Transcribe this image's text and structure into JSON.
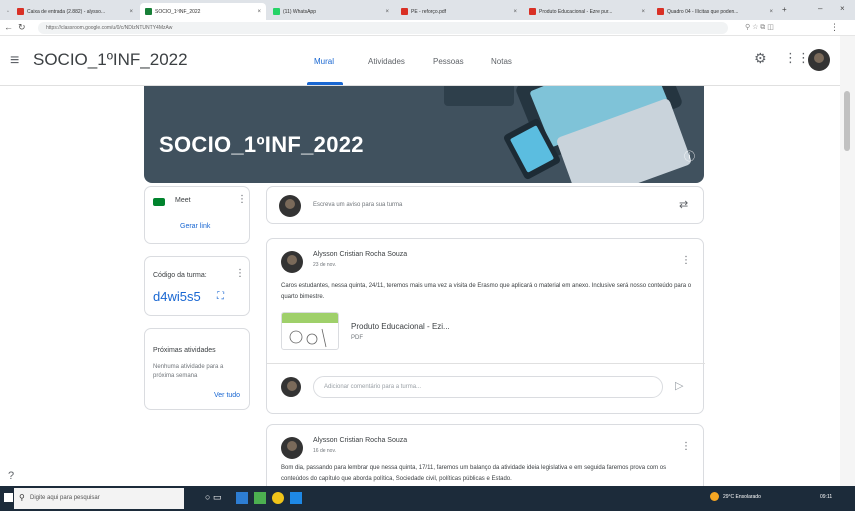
{
  "browser": {
    "tabs": [
      {
        "label": "Caixa de entrada (2.882) - alysso...",
        "color": "#d93025",
        "active": false
      },
      {
        "label": "SOCIO_1ºINF_2022",
        "color": "#188038",
        "active": true
      },
      {
        "label": "(11) WhatsApp",
        "color": "#25d366",
        "active": false
      },
      {
        "label": "PE - reforço.pdf",
        "color": "#d93025",
        "active": false
      },
      {
        "label": "Produto Educacional - Ezre pur...",
        "color": "#d93025",
        "active": false
      },
      {
        "label": "Quadro 04 - Ilícitas que poden...",
        "color": "#d93025",
        "active": false
      }
    ],
    "url": "https://classroom.google.com/u/0/c/NDIzNTUNTY4MzAw",
    "new_tab": "+"
  },
  "header": {
    "menu_icon": "≡",
    "title": "SOCIO_1ºINF_2022",
    "tabs": [
      "Mural",
      "Atividades",
      "Pessoas",
      "Notas"
    ]
  },
  "banner": {
    "title": "SOCIO_1ºINF_2022",
    "info_icon": "ⓘ"
  },
  "meet": {
    "label": "Meet",
    "link": "Gerar link"
  },
  "class_code": {
    "label": "Código da turma:",
    "code": "d4wi5s5"
  },
  "upcoming": {
    "title": "Próximas atividades",
    "empty": "Nenhuma atividade para a próxima semana",
    "link": "Ver tudo"
  },
  "compose": {
    "placeholder": "Escreva um aviso para sua turma"
  },
  "posts": [
    {
      "author": "Alysson Cristian Rocha Souza",
      "date": "23 de nov.",
      "body": "Caros estudantes, nessa quinta, 24/11, teremos mais uma vez a visita de Erasmo que aplicará o material em anexo. Inclusive será nosso conteúdo para o quarto bimestre.",
      "attachment": {
        "name": "Produto Educacional - Ezi...",
        "type": "PDF"
      },
      "comment_placeholder": "Adicionar comentário para a turma..."
    },
    {
      "author": "Alysson Cristian Rocha Souza",
      "date": "16 de nov.",
      "body": "Bom dia, passando para lembrar que nessa quinta, 17/11, faremos um balanço da atividade ideia legislativa e em seguida faremos prova com os conteúdos do capítulo que aborda política, Sociedade civil, políticas públicas e Estado."
    }
  ],
  "taskbar": {
    "search": "Digite aqui para pesquisar",
    "weather": "29°C Ensolarado",
    "time": "09:11"
  }
}
